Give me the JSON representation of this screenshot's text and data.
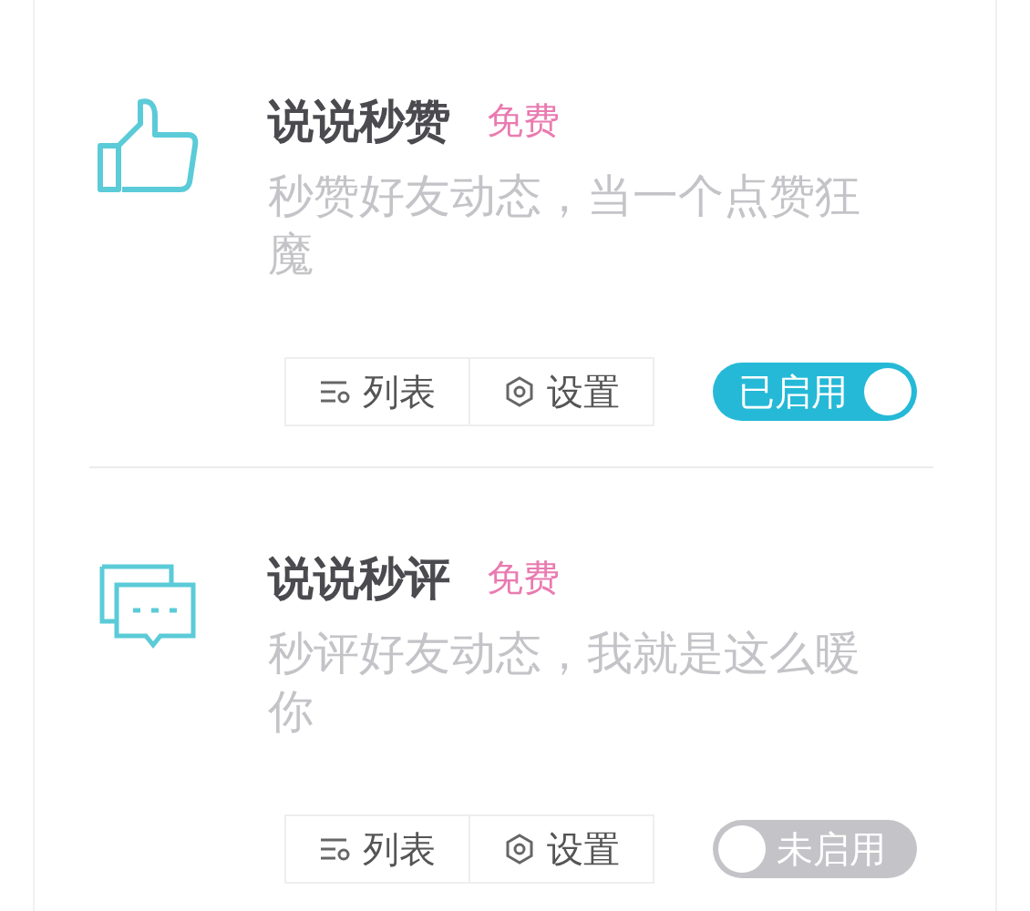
{
  "features": [
    {
      "kind": "thumb",
      "title": "说说秒赞",
      "badge": "免费",
      "description": "秒赞好友动态，当一个点赞狂魔",
      "buttons": [
        {
          "kind": "list",
          "label": "列表"
        },
        {
          "kind": "settings",
          "label": "设置"
        }
      ],
      "toggle": {
        "label": "已启用",
        "on": true
      }
    },
    {
      "kind": "chat",
      "title": "说说秒评",
      "badge": "免费",
      "description": "秒评好友动态，我就是这么暖你",
      "buttons": [
        {
          "kind": "list",
          "label": "列表"
        },
        {
          "kind": "settings",
          "label": "设置"
        }
      ],
      "toggle": {
        "label": "未启用",
        "on": false
      }
    }
  ]
}
